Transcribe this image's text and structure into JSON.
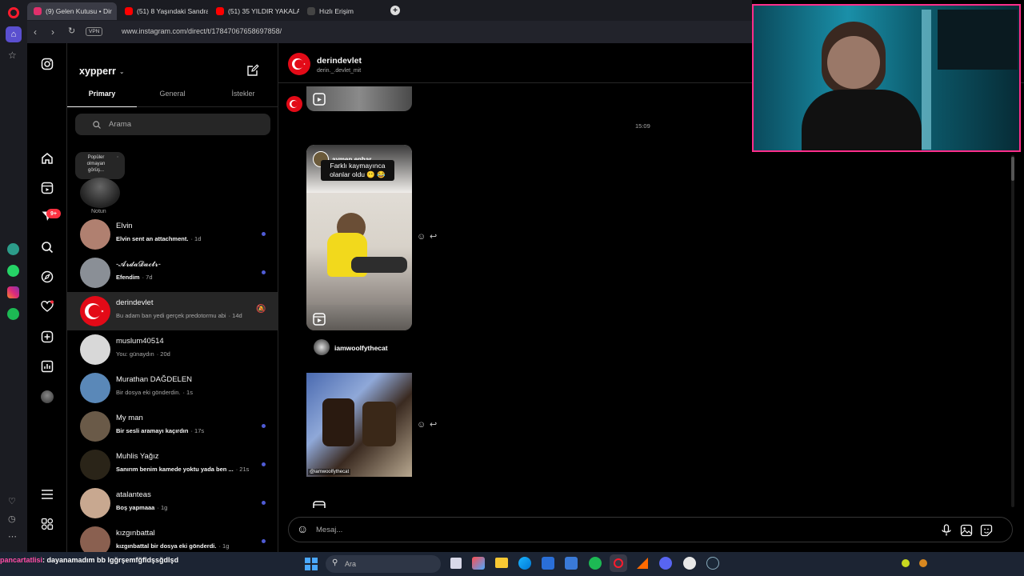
{
  "browser": {
    "tabs": [
      {
        "label": "(9) Gelen Kutusu • Dir",
        "color": "#e1306c"
      },
      {
        "label": "(51) 8 Yaşındaki Sandra Ca",
        "color": "#ff0000"
      },
      {
        "label": "(51) 35 YILDIR YAKALANA",
        "color": "#ff0000"
      },
      {
        "label": "Hızlı Erişim",
        "color": "#444444"
      }
    ],
    "new_tab": "+",
    "url": "www.instagram.com/direct/t/17847067658697858/",
    "vpn": "VPN"
  },
  "inbox": {
    "username": "xypperr",
    "tabs": [
      "Primary",
      "General",
      "İstekler"
    ],
    "active_tab": "Primary",
    "search_placeholder": "Arama",
    "note": {
      "bubble": "Popüler olmayan görüş...",
      "label": "Notun"
    },
    "conversations": [
      {
        "name": "Elvin",
        "preview": "Elvin sent an attachment.",
        "time": "· 1d",
        "unread": true,
        "bold": true,
        "avatar": "#b08070"
      },
      {
        "name": "-𝓐𝓻𝓭𝓪𝓓𝓪𝓬𝓽𝓻-",
        "preview": "Efendim",
        "time": "· 7d",
        "unread": true,
        "bold": true,
        "avatar": "#8a8f96"
      },
      {
        "name": "derindevlet",
        "preview": "Bu adam ban yedi gerçek predotormu abi",
        "time": "· 14d",
        "unread": false,
        "bold": false,
        "avatar": "#e30a17"
      },
      {
        "name": "muslum40514",
        "preview": "You: günaydın",
        "time": "· 20d",
        "unread": false,
        "bold": false,
        "avatar": "#d8d8d8"
      },
      {
        "name": "Murathan DAĞDELEN",
        "preview": "Bir dosya eki gönderdin.",
        "time": "· 1s",
        "unread": false,
        "bold": false,
        "avatar": "#5a88b8"
      },
      {
        "name": "My man",
        "preview": "Bir sesli aramayı kaçırdın",
        "time": "· 17s",
        "unread": true,
        "bold": true,
        "avatar": "#6a5a48"
      },
      {
        "name": "Muhlis Yağız",
        "preview": "Sanırım benim kamede yoktu yada ben ...",
        "time": "· 21s",
        "unread": true,
        "bold": true,
        "avatar": "#2a2418"
      },
      {
        "name": "atalanteas",
        "preview": "Boş yapmaaa",
        "time": "· 1g",
        "unread": true,
        "bold": true,
        "avatar": "#c8a890"
      },
      {
        "name": "kızgınbattal",
        "preview": "kızgınbattal bir dosya eki gönderdi.",
        "time": "· 1g",
        "unread": true,
        "bold": true,
        "avatar": "#8a6050"
      }
    ]
  },
  "rail": {
    "notif_badge": "9+"
  },
  "chat": {
    "name": "derindevlet",
    "subtitle": "derin._.devlet_mit",
    "timestamp": "15:09",
    "post1": {
      "author": "aymen.enhar_",
      "caption": "Farklı kaymayınca olanlar oldu 😶 😂"
    },
    "post2": {
      "author": "iamwoolfythecat",
      "watermark": "@iamwoolfythecat"
    },
    "composer_placeholder": "Mesaj..."
  },
  "taskbar": {
    "search_placeholder": "Ara",
    "chat_overlay": {
      "user": "pancartatlisi",
      "message": ": dayanamadım bb lgğrşemfğfldşsğdlşd"
    }
  },
  "colors": {
    "accent": "#4f5bd5",
    "webcam_border": "#ff2d8a",
    "flag": "#e30a17"
  }
}
